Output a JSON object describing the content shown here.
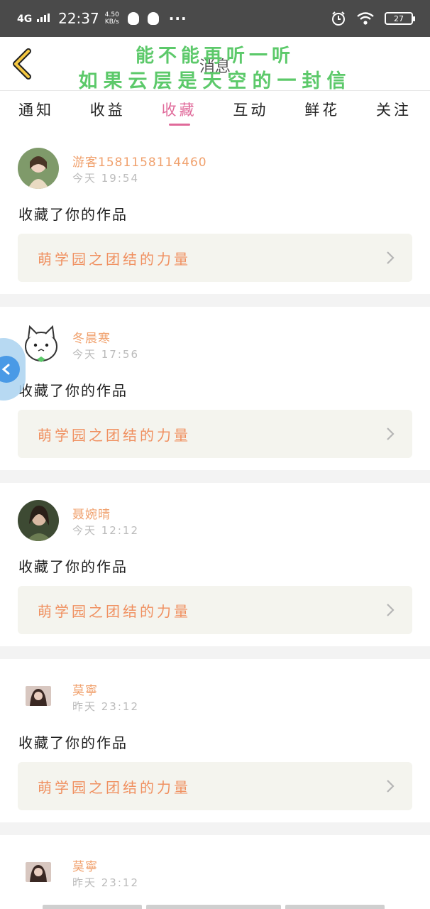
{
  "status_bar": {
    "network": "4G",
    "time": "22:37",
    "speed_value": "4.50",
    "speed_unit": "KB/s",
    "more": "···",
    "battery": "27"
  },
  "header": {
    "title": "消息",
    "overlay_line1": "能不能再听一听",
    "overlay_line2": "如果云层是天空的一封信"
  },
  "tabs": [
    {
      "label": "通知",
      "active": false
    },
    {
      "label": "收益",
      "active": false
    },
    {
      "label": "收藏",
      "active": true
    },
    {
      "label": "互动",
      "active": false
    },
    {
      "label": "鲜花",
      "active": false
    },
    {
      "label": "关注",
      "active": false
    }
  ],
  "notifications": [
    {
      "user": "游客15811581144​60",
      "time": "今天 19:54",
      "action": "收藏了你的作品",
      "work_title": "萌学园之团结的力量"
    },
    {
      "user": "冬晨寒",
      "time": "今天 17:56",
      "action": "收藏了你的作品",
      "work_title": "萌学园之团结的力量"
    },
    {
      "user": "聂婉晴",
      "time": "今天 12:12",
      "action": "收藏了你的作品",
      "work_title": "萌学园之团结的力量"
    },
    {
      "user": "莫寧",
      "time": "昨天 23:12",
      "action": "收藏了你的作品",
      "work_title": "萌学园之团结的力量"
    },
    {
      "user": "莫寧",
      "time": "昨天 23:12",
      "action": "",
      "work_title": ""
    }
  ],
  "colors": {
    "accent": "#e06a9a",
    "username": "#f0a06c",
    "work_title": "#f09060",
    "overlay_text": "#5cc96a",
    "status_bar": "#4a4a4a"
  },
  "icons": {
    "back": "chevron-left-icon",
    "arrow": "chevron-right-icon",
    "float": "float-back-icon"
  }
}
